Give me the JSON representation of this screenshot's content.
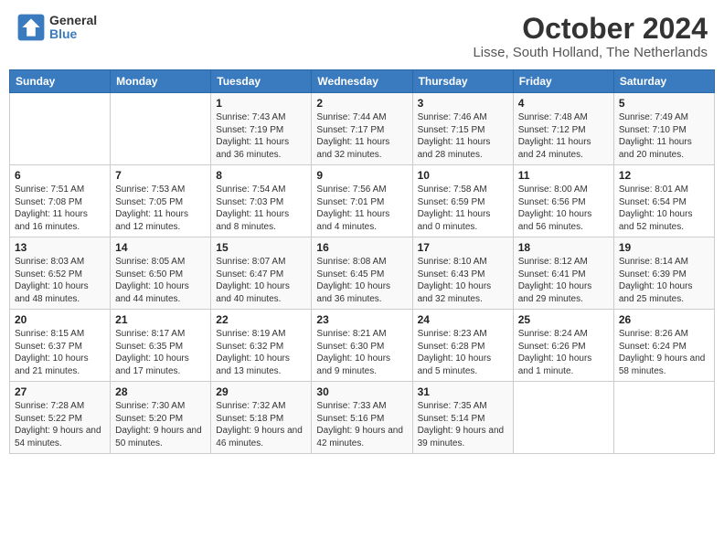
{
  "header": {
    "logo_line1": "General",
    "logo_line2": "Blue",
    "title": "October 2024",
    "subtitle": "Lisse, South Holland, The Netherlands"
  },
  "weekdays": [
    "Sunday",
    "Monday",
    "Tuesday",
    "Wednesday",
    "Thursday",
    "Friday",
    "Saturday"
  ],
  "weeks": [
    [
      {
        "day": "",
        "sunrise": "",
        "sunset": "",
        "daylight": ""
      },
      {
        "day": "",
        "sunrise": "",
        "sunset": "",
        "daylight": ""
      },
      {
        "day": "1",
        "sunrise": "Sunrise: 7:43 AM",
        "sunset": "Sunset: 7:19 PM",
        "daylight": "Daylight: 11 hours and 36 minutes."
      },
      {
        "day": "2",
        "sunrise": "Sunrise: 7:44 AM",
        "sunset": "Sunset: 7:17 PM",
        "daylight": "Daylight: 11 hours and 32 minutes."
      },
      {
        "day": "3",
        "sunrise": "Sunrise: 7:46 AM",
        "sunset": "Sunset: 7:15 PM",
        "daylight": "Daylight: 11 hours and 28 minutes."
      },
      {
        "day": "4",
        "sunrise": "Sunrise: 7:48 AM",
        "sunset": "Sunset: 7:12 PM",
        "daylight": "Daylight: 11 hours and 24 minutes."
      },
      {
        "day": "5",
        "sunrise": "Sunrise: 7:49 AM",
        "sunset": "Sunset: 7:10 PM",
        "daylight": "Daylight: 11 hours and 20 minutes."
      }
    ],
    [
      {
        "day": "6",
        "sunrise": "Sunrise: 7:51 AM",
        "sunset": "Sunset: 7:08 PM",
        "daylight": "Daylight: 11 hours and 16 minutes."
      },
      {
        "day": "7",
        "sunrise": "Sunrise: 7:53 AM",
        "sunset": "Sunset: 7:05 PM",
        "daylight": "Daylight: 11 hours and 12 minutes."
      },
      {
        "day": "8",
        "sunrise": "Sunrise: 7:54 AM",
        "sunset": "Sunset: 7:03 PM",
        "daylight": "Daylight: 11 hours and 8 minutes."
      },
      {
        "day": "9",
        "sunrise": "Sunrise: 7:56 AM",
        "sunset": "Sunset: 7:01 PM",
        "daylight": "Daylight: 11 hours and 4 minutes."
      },
      {
        "day": "10",
        "sunrise": "Sunrise: 7:58 AM",
        "sunset": "Sunset: 6:59 PM",
        "daylight": "Daylight: 11 hours and 0 minutes."
      },
      {
        "day": "11",
        "sunrise": "Sunrise: 8:00 AM",
        "sunset": "Sunset: 6:56 PM",
        "daylight": "Daylight: 10 hours and 56 minutes."
      },
      {
        "day": "12",
        "sunrise": "Sunrise: 8:01 AM",
        "sunset": "Sunset: 6:54 PM",
        "daylight": "Daylight: 10 hours and 52 minutes."
      }
    ],
    [
      {
        "day": "13",
        "sunrise": "Sunrise: 8:03 AM",
        "sunset": "Sunset: 6:52 PM",
        "daylight": "Daylight: 10 hours and 48 minutes."
      },
      {
        "day": "14",
        "sunrise": "Sunrise: 8:05 AM",
        "sunset": "Sunset: 6:50 PM",
        "daylight": "Daylight: 10 hours and 44 minutes."
      },
      {
        "day": "15",
        "sunrise": "Sunrise: 8:07 AM",
        "sunset": "Sunset: 6:47 PM",
        "daylight": "Daylight: 10 hours and 40 minutes."
      },
      {
        "day": "16",
        "sunrise": "Sunrise: 8:08 AM",
        "sunset": "Sunset: 6:45 PM",
        "daylight": "Daylight: 10 hours and 36 minutes."
      },
      {
        "day": "17",
        "sunrise": "Sunrise: 8:10 AM",
        "sunset": "Sunset: 6:43 PM",
        "daylight": "Daylight: 10 hours and 32 minutes."
      },
      {
        "day": "18",
        "sunrise": "Sunrise: 8:12 AM",
        "sunset": "Sunset: 6:41 PM",
        "daylight": "Daylight: 10 hours and 29 minutes."
      },
      {
        "day": "19",
        "sunrise": "Sunrise: 8:14 AM",
        "sunset": "Sunset: 6:39 PM",
        "daylight": "Daylight: 10 hours and 25 minutes."
      }
    ],
    [
      {
        "day": "20",
        "sunrise": "Sunrise: 8:15 AM",
        "sunset": "Sunset: 6:37 PM",
        "daylight": "Daylight: 10 hours and 21 minutes."
      },
      {
        "day": "21",
        "sunrise": "Sunrise: 8:17 AM",
        "sunset": "Sunset: 6:35 PM",
        "daylight": "Daylight: 10 hours and 17 minutes."
      },
      {
        "day": "22",
        "sunrise": "Sunrise: 8:19 AM",
        "sunset": "Sunset: 6:32 PM",
        "daylight": "Daylight: 10 hours and 13 minutes."
      },
      {
        "day": "23",
        "sunrise": "Sunrise: 8:21 AM",
        "sunset": "Sunset: 6:30 PM",
        "daylight": "Daylight: 10 hours and 9 minutes."
      },
      {
        "day": "24",
        "sunrise": "Sunrise: 8:23 AM",
        "sunset": "Sunset: 6:28 PM",
        "daylight": "Daylight: 10 hours and 5 minutes."
      },
      {
        "day": "25",
        "sunrise": "Sunrise: 8:24 AM",
        "sunset": "Sunset: 6:26 PM",
        "daylight": "Daylight: 10 hours and 1 minute."
      },
      {
        "day": "26",
        "sunrise": "Sunrise: 8:26 AM",
        "sunset": "Sunset: 6:24 PM",
        "daylight": "Daylight: 9 hours and 58 minutes."
      }
    ],
    [
      {
        "day": "27",
        "sunrise": "Sunrise: 7:28 AM",
        "sunset": "Sunset: 5:22 PM",
        "daylight": "Daylight: 9 hours and 54 minutes."
      },
      {
        "day": "28",
        "sunrise": "Sunrise: 7:30 AM",
        "sunset": "Sunset: 5:20 PM",
        "daylight": "Daylight: 9 hours and 50 minutes."
      },
      {
        "day": "29",
        "sunrise": "Sunrise: 7:32 AM",
        "sunset": "Sunset: 5:18 PM",
        "daylight": "Daylight: 9 hours and 46 minutes."
      },
      {
        "day": "30",
        "sunrise": "Sunrise: 7:33 AM",
        "sunset": "Sunset: 5:16 PM",
        "daylight": "Daylight: 9 hours and 42 minutes."
      },
      {
        "day": "31",
        "sunrise": "Sunrise: 7:35 AM",
        "sunset": "Sunset: 5:14 PM",
        "daylight": "Daylight: 9 hours and 39 minutes."
      },
      {
        "day": "",
        "sunrise": "",
        "sunset": "",
        "daylight": ""
      },
      {
        "day": "",
        "sunrise": "",
        "sunset": "",
        "daylight": ""
      }
    ]
  ]
}
